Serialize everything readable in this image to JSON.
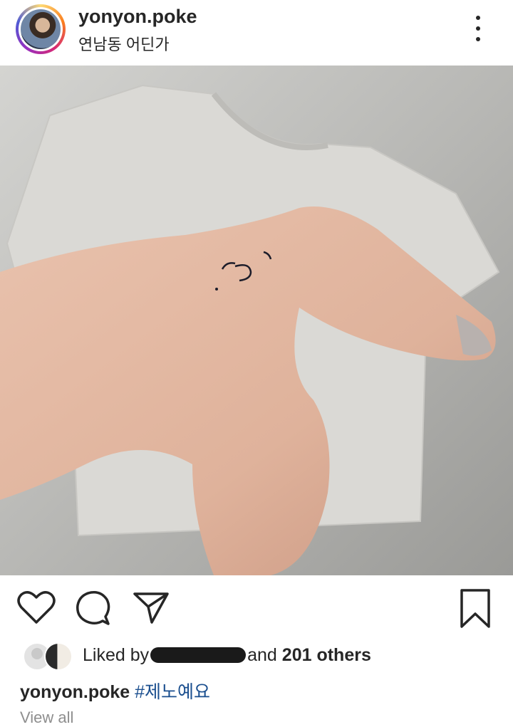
{
  "header": {
    "username": "yonyon.poke",
    "location": "연남동 어딘가"
  },
  "post": {
    "image_description_icon": "photo"
  },
  "actions": {
    "like_icon": "heart-icon",
    "comment_icon": "comment-icon",
    "share_icon": "paper-plane-icon",
    "save_icon": "bookmark-icon"
  },
  "likes": {
    "prefix": "Liked by",
    "middle": "and",
    "count": "201 others"
  },
  "caption": {
    "username": "yonyon.poke",
    "hashtag": "#제노예요"
  },
  "comments": {
    "view_all": "View all"
  },
  "colors": {
    "text": "#262626",
    "hashtag": "#1b4f8f",
    "muted": "#8e8e8e"
  }
}
